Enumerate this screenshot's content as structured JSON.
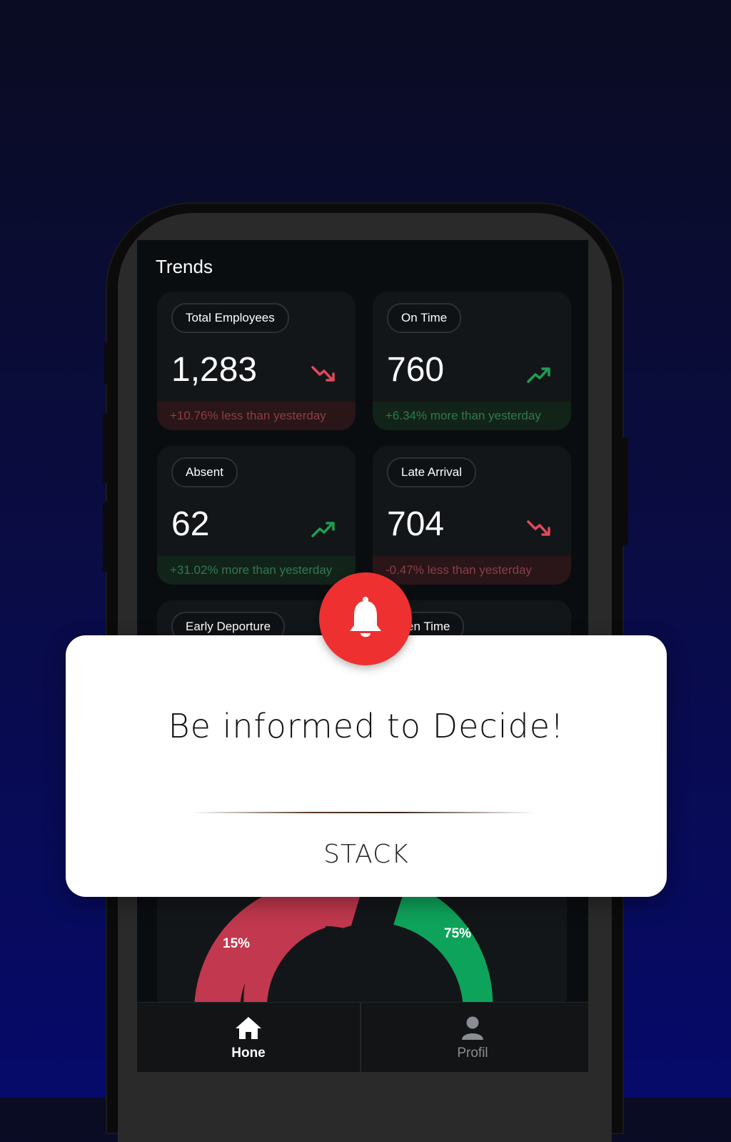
{
  "screen": {
    "title": "Trends"
  },
  "cards": [
    {
      "label": "Total Employees",
      "value": "1,283",
      "trend": "down",
      "note": "+10.76% less than yesterday"
    },
    {
      "label": "On Time",
      "value": "760",
      "trend": "up",
      "note": "+6.34% more than yesterday"
    },
    {
      "label": "Absent",
      "value": "62",
      "trend": "up",
      "note": "+31.02% more than yesterday"
    },
    {
      "label": "Late Arrival",
      "value": "704",
      "trend": "down",
      "note": "-0.47% less than yesterday"
    },
    {
      "label": "Early Deporture"
    },
    {
      "label": "en Time"
    }
  ],
  "chart": {
    "left_label": "15%",
    "right_label": "75%"
  },
  "tabbar": {
    "home_label": "Hone",
    "profile_label": "Profil"
  },
  "modal": {
    "heading": "Be informed to Decide!",
    "action": "STACK"
  },
  "colors": {
    "alert": "#ee3030",
    "positive": "#1f9d55",
    "negative": "#e04a5a"
  }
}
